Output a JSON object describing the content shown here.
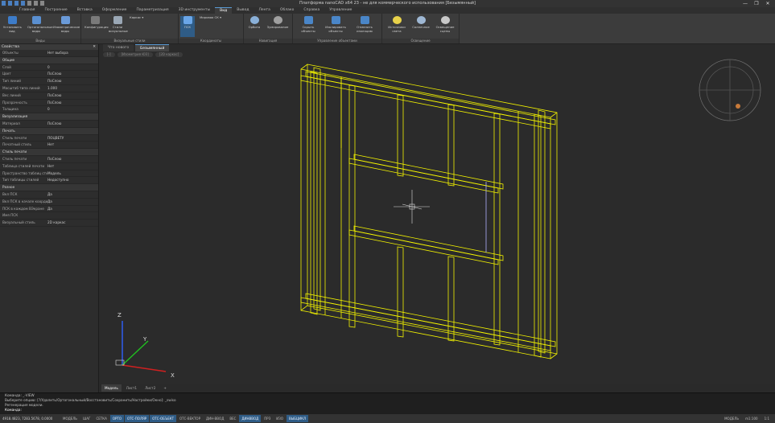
{
  "app": {
    "title": "Платформа nanoCAD x64 23 - не для коммерческого использования [Безымянный]",
    "window_buttons": [
      "—",
      "❐",
      "✕"
    ]
  },
  "ribbon_tabs": [
    "Главная",
    "Построение",
    "Вставка",
    "Оформление",
    "Параметризация",
    "3D инструменты",
    "Вид",
    "Вывод",
    "Лента",
    "Облако",
    "Справка",
    "Управление"
  ],
  "ribbon_groups": [
    {
      "label": "Виды",
      "buttons": [
        "Установить вид",
        "Ортогональные виды",
        "Изометрические виды"
      ]
    },
    {
      "label": "Визуальные стили",
      "buttons": [
        "Конфигурация",
        "Стили визуальные",
        "Каркас"
      ]
    },
    {
      "label": "Координаты",
      "buttons": [
        "ПСК",
        "Мировая СК"
      ]
    },
    {
      "label": "Навигация",
      "buttons": [
        "Орбита",
        "Зумирование"
      ]
    },
    {
      "label": "Управление объектами",
      "buttons": [
        "Скрыть объекты",
        "Изолировать объекты",
        "Отменить изоляцию"
      ]
    },
    {
      "label": "Освещение",
      "buttons": [
        "Источники света",
        "Солнечное",
        "Освещение сцены"
      ]
    }
  ],
  "properties": {
    "title": "Свойства",
    "rows": [
      {
        "k": "Объекты",
        "v": "Нет выбора",
        "sec": false
      },
      {
        "k": "Общие",
        "v": "",
        "sec": true
      },
      {
        "k": "Слой",
        "v": "0",
        "sec": false
      },
      {
        "k": "Цвет",
        "v": "ПоСлою",
        "sec": false
      },
      {
        "k": "Тип линий",
        "v": "ПоСлою",
        "sec": false
      },
      {
        "k": "Масштаб типа линий",
        "v": "1.000",
        "sec": false
      },
      {
        "k": "Вес линий",
        "v": "ПоСлою",
        "sec": false
      },
      {
        "k": "Прозрачность",
        "v": "ПоСлою",
        "sec": false
      },
      {
        "k": "Толщина",
        "v": "0",
        "sec": false
      },
      {
        "k": "Визуализация",
        "v": "",
        "sec": true
      },
      {
        "k": "Материал",
        "v": "ПоСлою",
        "sec": false
      },
      {
        "k": "Печать",
        "v": "",
        "sec": true
      },
      {
        "k": "Стиль печати",
        "v": "ПОЦВЕТУ",
        "sec": false
      },
      {
        "k": "Печатный стиль",
        "v": "Нет",
        "sec": false
      },
      {
        "k": "Стиль печати",
        "v": "",
        "sec": true
      },
      {
        "k": "Стиль печати",
        "v": "ПоСлою",
        "sec": false
      },
      {
        "k": "Таблица стилей печати",
        "v": "Нет",
        "sec": false
      },
      {
        "k": "Пространство таблиц стилей",
        "v": "Модель",
        "sec": false
      },
      {
        "k": "Тип таблицы стилей",
        "v": "Недоступно",
        "sec": false
      },
      {
        "k": "Разное",
        "v": "",
        "sec": true
      },
      {
        "k": "Вкл ПСК",
        "v": "Да",
        "sec": false
      },
      {
        "k": "Вкл ПСК в начале координат",
        "v": "Да",
        "sec": false
      },
      {
        "k": "ПСК в каждом ВЭкране",
        "v": "Да",
        "sec": false
      },
      {
        "k": "Имя ПСК",
        "v": "",
        "sec": false
      },
      {
        "k": "Визуальный стиль",
        "v": "2D каркас",
        "sec": false
      }
    ]
  },
  "doc_tabs": [
    "Что нового",
    "Безымянный"
  ],
  "viewport_tabs": [
    "[-]",
    "[Изометрия ЮЗ]",
    "[2D каркас]"
  ],
  "layout_tabs": [
    "Модель",
    "Лист1",
    "Лист2",
    "+"
  ],
  "command_lines": [
    "Команда: _-VIEW",
    "Выберите опцию: [?/Удалить/Ортогональный/Восстановить/Сохранить/Настройки/Окно]: _swiso",
    "Регенерация модели.",
    "Команда:"
  ],
  "status": {
    "coords": "4918.4823, 7283.5678, 0.0000",
    "buttons": [
      {
        "label": "МОДЕЛЬ",
        "on": false
      },
      {
        "label": "ШАГ",
        "on": false
      },
      {
        "label": "СЕТКА",
        "on": false
      },
      {
        "label": "ОРТО",
        "on": true
      },
      {
        "label": "ОТС-ПОЛЯР",
        "on": true
      },
      {
        "label": "ОТС-ОБЪЕКТ",
        "on": true
      },
      {
        "label": "ОТС-ВЕКТОР",
        "on": false
      },
      {
        "label": "ДИН-ВВОД",
        "on": false
      },
      {
        "label": "ВЕС",
        "on": false
      },
      {
        "label": "ДИНВВОД",
        "on": true
      },
      {
        "label": "ПРЗ",
        "on": false
      },
      {
        "label": "ИЗО",
        "on": false
      },
      {
        "label": "ВЫБЦИКЛ",
        "on": true
      }
    ],
    "right": [
      "МОДЕЛЬ",
      "m1:100",
      "1:1"
    ]
  },
  "axes": {
    "x": "X",
    "y": "Y",
    "z": "Z"
  },
  "colors": {
    "wire": "#f2f200",
    "axis_x": "#d02020",
    "axis_y": "#20c020",
    "axis_z": "#3060ff",
    "accent": "#2f5c86"
  }
}
